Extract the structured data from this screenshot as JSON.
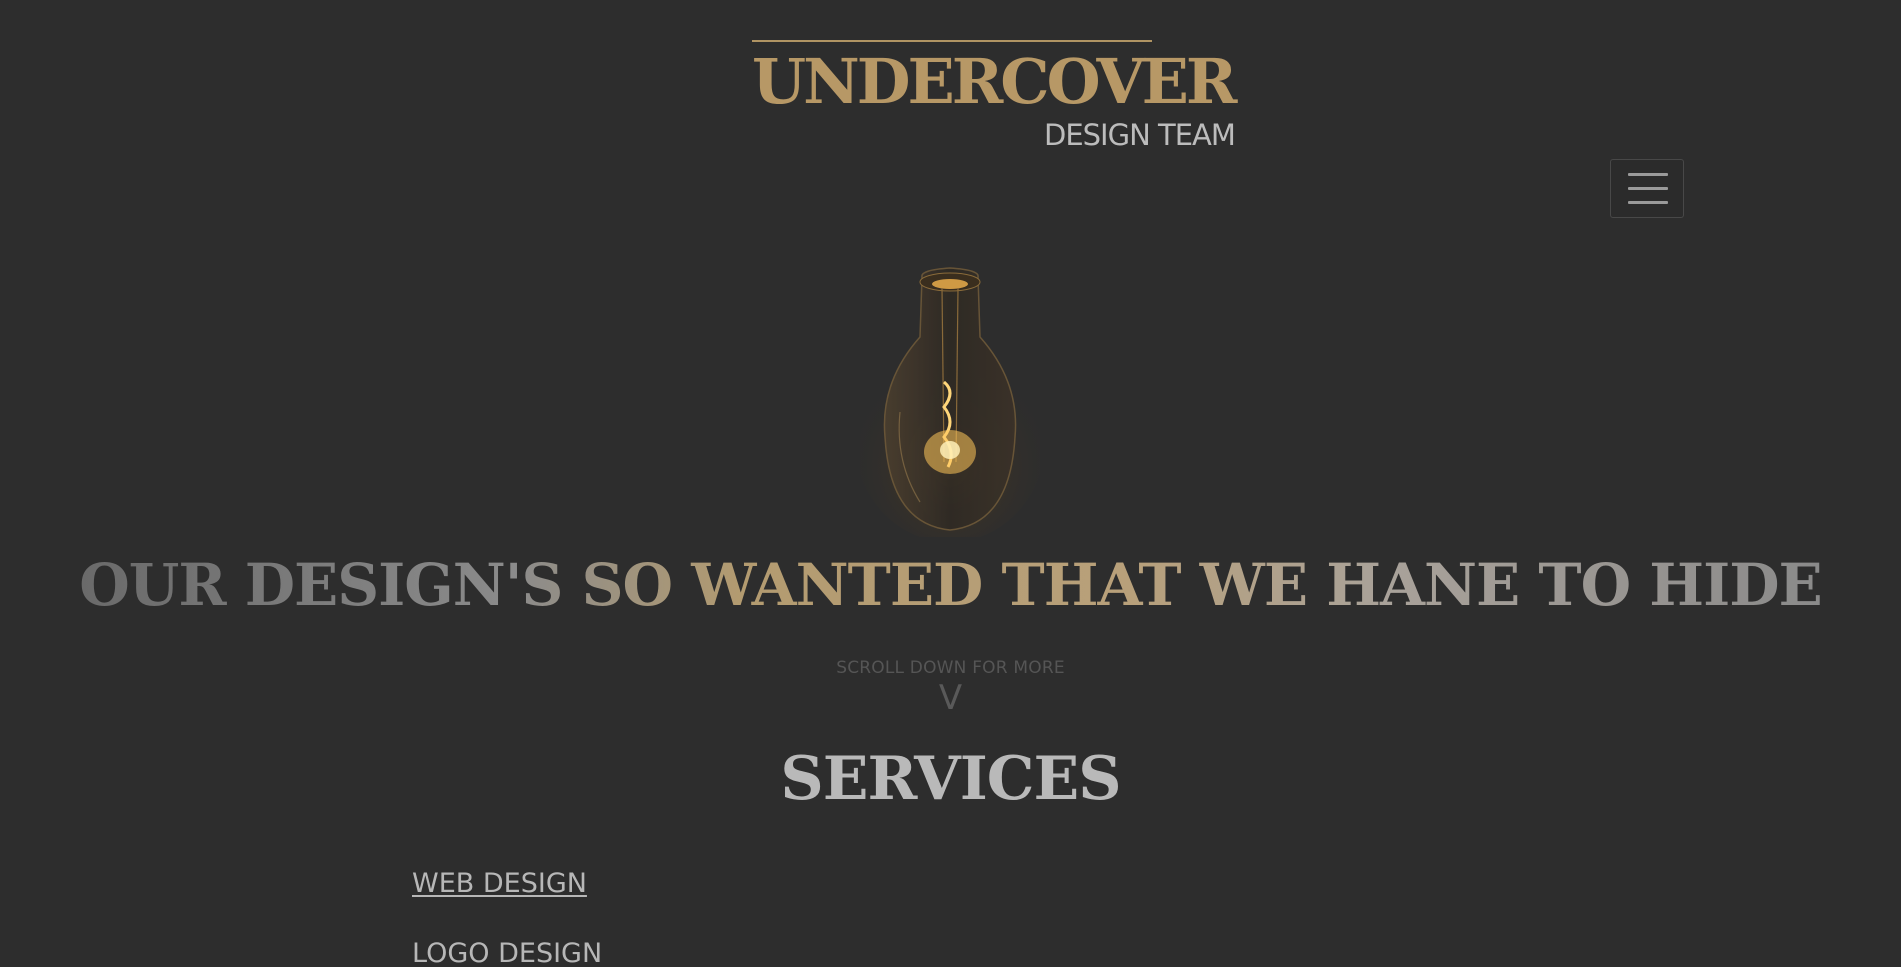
{
  "logo": {
    "title": "UNDERCOVER",
    "subtitle": "DESIGN TEAM",
    "accent_color": "#b79866"
  },
  "nav": {
    "menu_icon": "hamburger-menu-icon"
  },
  "hero": {
    "image": "light-bulb",
    "tagline": "OUR DESIGN'S SO WANTED THAT WE HANE TO HIDE",
    "scroll_hint": "SCROLL DOWN FOR MORE",
    "scroll_arrow": "V"
  },
  "services": {
    "title": "SERVICES",
    "items": [
      {
        "label": "WEB DESIGN"
      },
      {
        "label": "LOGO DESIGN"
      }
    ]
  },
  "colors": {
    "background": "#2d2d2d",
    "text": "#b8b8b8"
  }
}
